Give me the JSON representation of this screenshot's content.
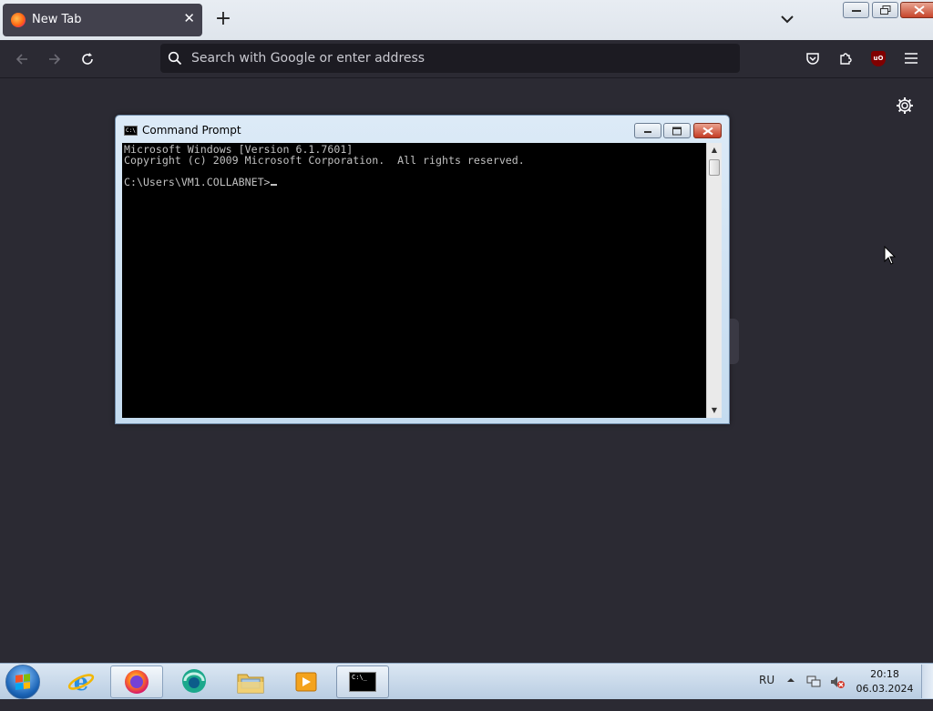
{
  "browser": {
    "tab": {
      "title": "New Tab"
    },
    "urlbar": {
      "placeholder": "Search with Google or enter address"
    }
  },
  "cmd_window": {
    "title": "Command Prompt",
    "icon_text": "C:\\",
    "lines": [
      "Microsoft Windows [Version 6.1.7601]",
      "Copyright (c) 2009 Microsoft Corporation.  All rights reserved.",
      "",
      "C:\\Users\\VM1.COLLABNET>"
    ]
  },
  "taskbar": {
    "language": "RU",
    "time": "20:18",
    "date": "06.03.2024",
    "cmd_icon_text": "C:\\_"
  },
  "colors": {
    "browser_bg": "#2b2a33",
    "tab_active": "#42414d",
    "console_bg": "#000000",
    "console_text": "#c0c0c0"
  }
}
